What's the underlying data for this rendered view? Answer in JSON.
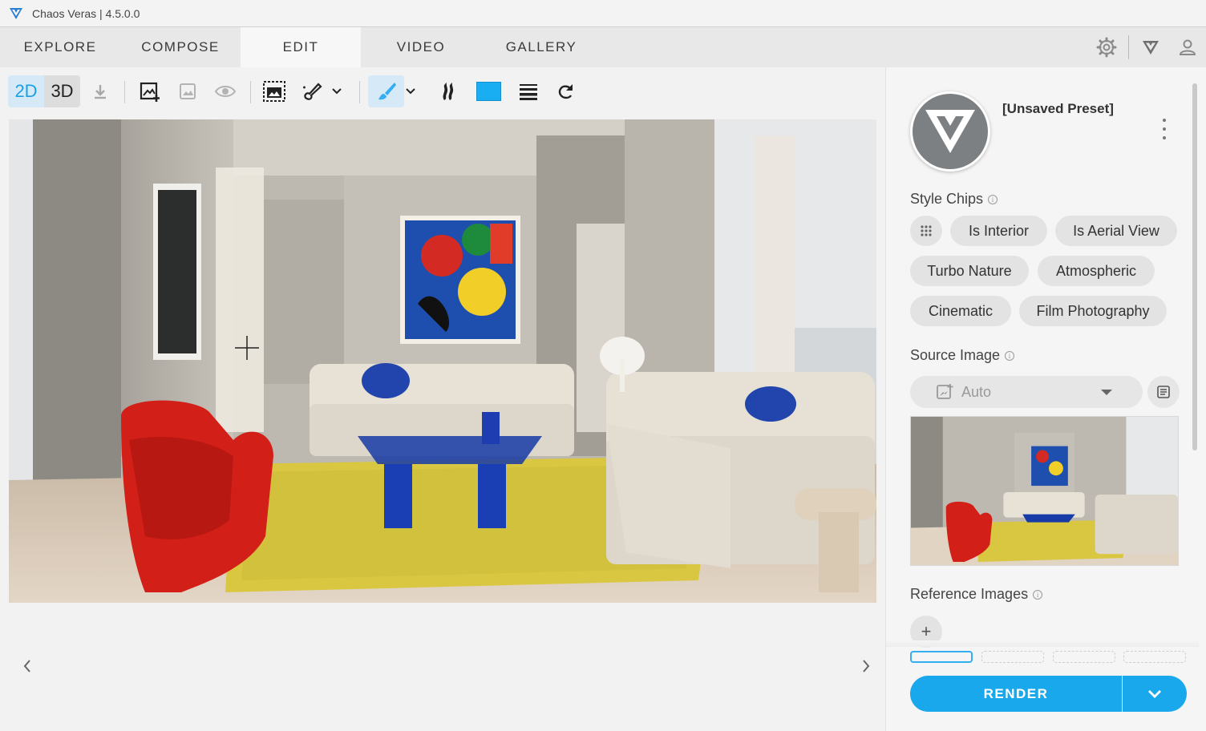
{
  "app": {
    "title": "Chaos Veras | 4.5.0.0"
  },
  "tabs": [
    {
      "label": "EXPLORE",
      "active": false
    },
    {
      "label": "COMPOSE",
      "active": false
    },
    {
      "label": "EDIT",
      "active": true
    },
    {
      "label": "VIDEO",
      "active": false
    },
    {
      "label": "GALLERY",
      "active": false
    }
  ],
  "header_icons": [
    "gear-icon",
    "veras-logo-icon",
    "user-icon"
  ],
  "toolbar": {
    "mode_2d": "2D",
    "mode_3d": "3D",
    "active_mode": "2D",
    "icons": [
      "download-icon",
      "add-image-icon",
      "image-icon",
      "eye-icon",
      "region-select-icon",
      "magic-brush-icon",
      "brush-icon",
      "flame-icon",
      "color-swatch",
      "line-weight-icon",
      "redo-icon"
    ],
    "swatch_color": "#1aa8ec"
  },
  "panel": {
    "preset_name": "[Unsaved Preset]",
    "style_chips_label": "Style Chips",
    "chips": [
      "Is Interior",
      "Is Aerial View",
      "Turbo Nature",
      "Atmospheric",
      "Cinematic",
      "Film Photography"
    ],
    "source_image_label": "Source Image",
    "source_image_value": "Auto",
    "reference_images_label": "Reference Images",
    "render_label": "RENDER"
  },
  "colors": {
    "accent": "#1aa8ec",
    "active_tab_bg": "#f7f7f7",
    "tabbar_bg": "#e8e8e8"
  }
}
